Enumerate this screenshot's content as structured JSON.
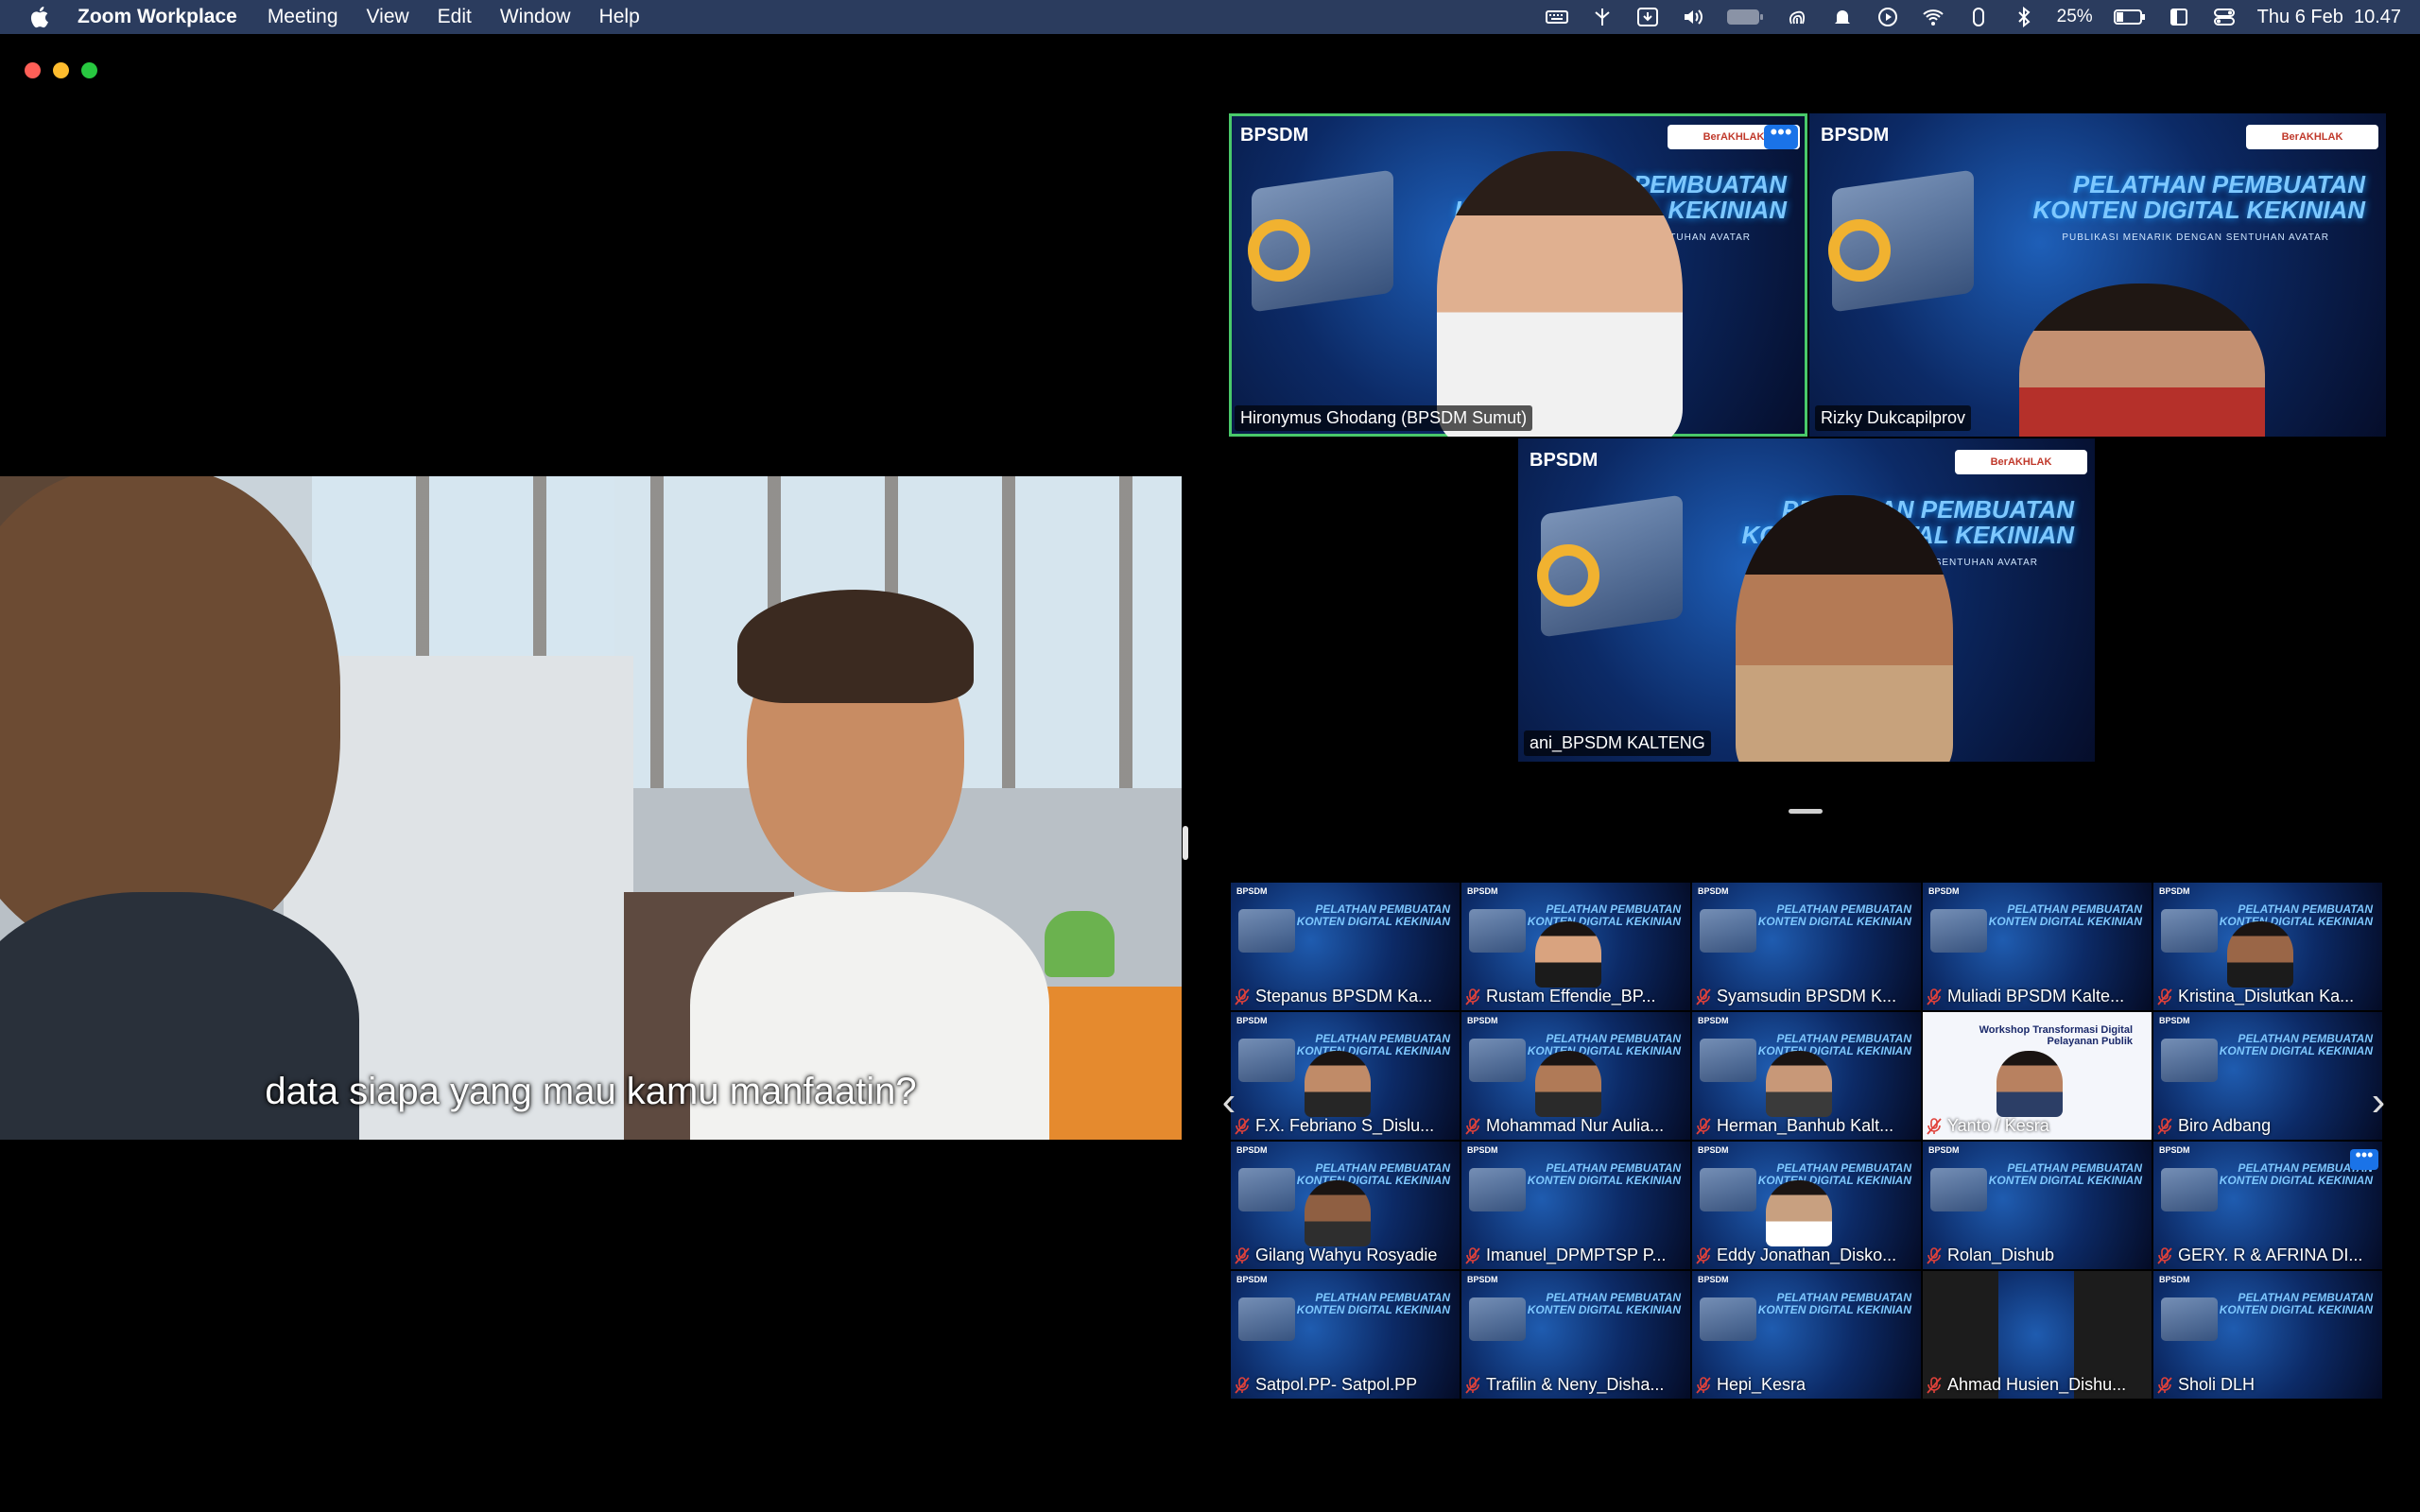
{
  "menubar": {
    "app_name": "Zoom Workplace",
    "menus": [
      "Meeting",
      "View",
      "Edit",
      "Window",
      "Help"
    ],
    "battery_percent": "25%",
    "battery_badge": "25",
    "datetime": "Thu 6 Feb  10.47"
  },
  "shared_screen": {
    "subtitle": "data siapa yang mau kamu manfaatin?"
  },
  "speakers": [
    {
      "name": "Hironymus Ghodang (BPSDM Sumut)",
      "active": true
    },
    {
      "name": "Rizky Dukcapilprov",
      "active": false
    },
    {
      "name": "ani_BPSDM KALTENG",
      "active": false
    }
  ],
  "background": {
    "logo": "BPSDM",
    "title_line1": "PELATHAN PEMBUATAN",
    "title_line2": "KONTEN DIGITAL KEKINIAN",
    "subtitle": "PUBLIKASI MENARIK DENGAN SENTUHAN AVATAR",
    "badge": "BerAKHLAK"
  },
  "workshop_tile": {
    "title_line1": "Workshop Transformasi Digital",
    "title_line2": "Pelayanan Publik"
  },
  "more_button_label": "•••",
  "gallery": [
    "Stepanus BPSDM  Ka...",
    "Rustam Effendie_BP...",
    "Syamsudin BPSDM K...",
    "Muliadi BPSDM Kalte...",
    "Kristina_Dislutkan Ka...",
    "F.X. Febriano S_Dislu...",
    "Mohammad Nur Aulia...",
    "Herman_Banhub Kalt...",
    "Yanto / Kesra",
    "Biro Adbang",
    "Gilang Wahyu Rosyadie",
    "Imanuel_DPMPTSP P...",
    "Eddy Jonathan_Disko...",
    "Rolan_Dishub",
    "GERY. R & AFRINA DI...",
    "Satpol.PP- Satpol.PP",
    "Trafilin & Neny_Disha...",
    "Hepi_Kesra",
    "Ahmad Husien_Dishu...",
    "Sholi DLH"
  ],
  "colors": {
    "menubar": "#2b3c5e",
    "active_speaker_border": "#49c96a",
    "accent": "#1a73e8",
    "muted": "#e0413a"
  }
}
